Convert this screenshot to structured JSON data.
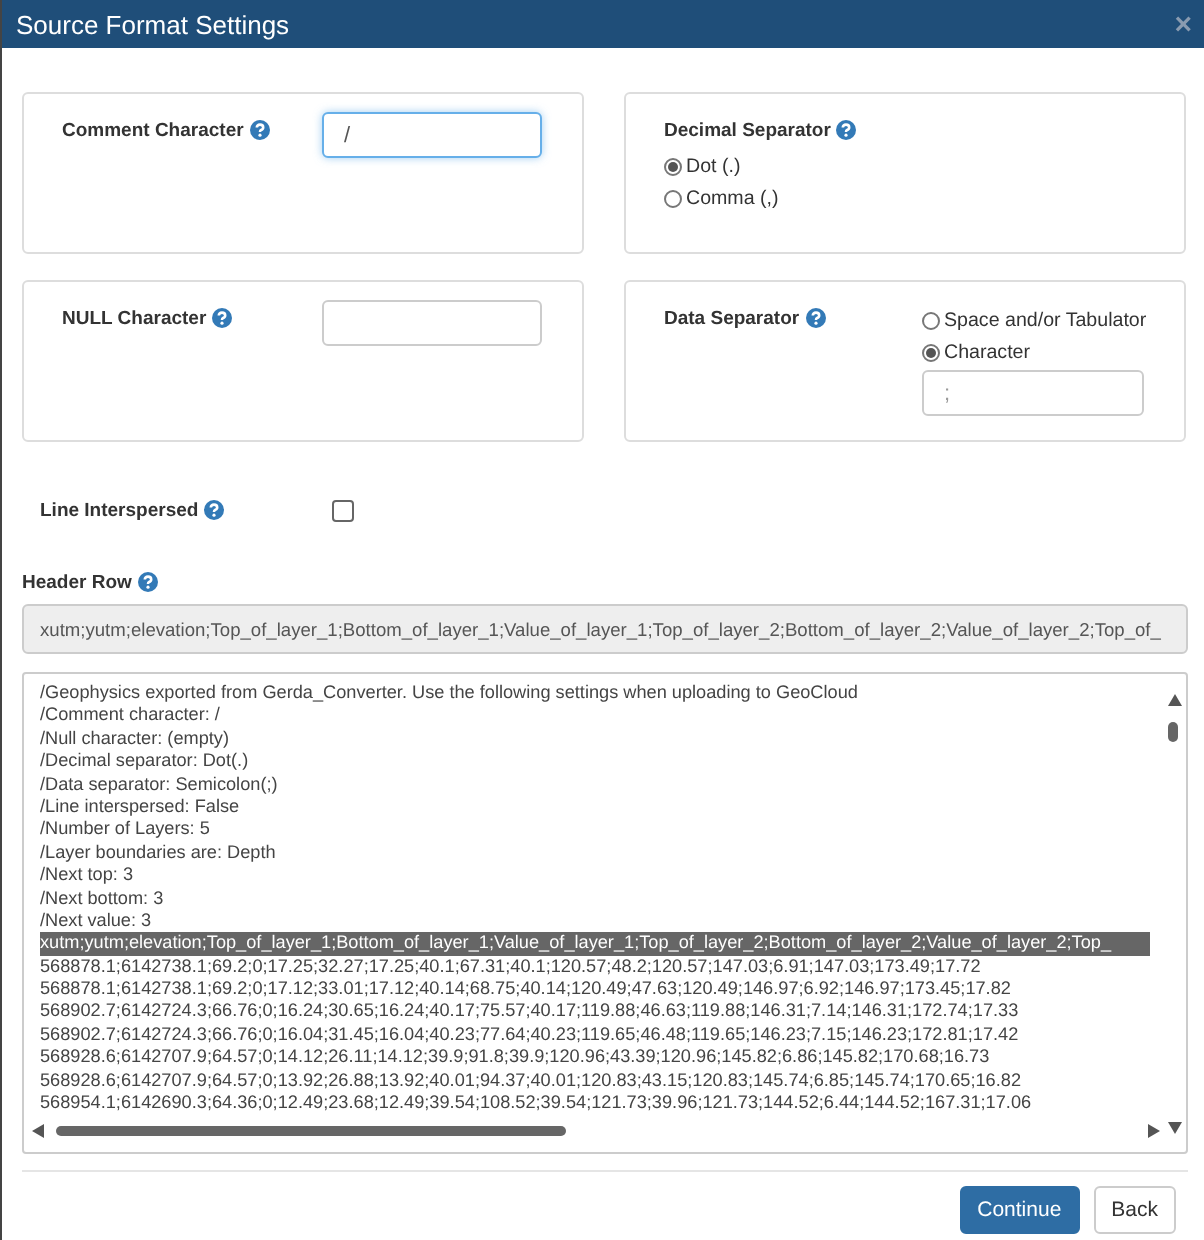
{
  "window": {
    "title": "Source Format Settings",
    "close": "×"
  },
  "settings": [
    {
      "kind": "text",
      "label": "Comment Character",
      "value": "/",
      "focused": true
    },
    {
      "kind": "radio",
      "label": "Decimal Separator",
      "options": [
        {
          "label": "Dot (.)",
          "selected": true
        },
        {
          "label": "Comma (,)",
          "selected": false
        }
      ]
    },
    {
      "kind": "text",
      "label": "NULL Character",
      "focused": false
    },
    {
      "kind": "radio-side",
      "label": "Data Separator",
      "options": [
        {
          "label": "Space and/or Tabulator",
          "selected": false
        },
        {
          "label": "Character",
          "selected": true,
          "placeholder": ";"
        }
      ]
    }
  ],
  "line_interspersed": {
    "label": "Line Interspersed",
    "checked": false
  },
  "header_row": {
    "label": "Header Row",
    "value": "xutm;yutm;elevation;Top_of_layer_1;Bottom_of_layer_1;Value_of_layer_1;Top_of_layer_2;Bottom_of_layer_2;Value_of_layer_2;Top_of_"
  },
  "preview": {
    "lines": [
      {
        "text": "/Geophysics exported from Gerda_Converter. Use the following settings when uploading to GeoCloud",
        "selected": false
      },
      {
        "text": "/Comment character: /",
        "selected": false
      },
      {
        "text": "/Null character: (empty)",
        "selected": false
      },
      {
        "text": "/Decimal separator: Dot(.)",
        "selected": false
      },
      {
        "text": "/Data separator: Semicolon(;)",
        "selected": false
      },
      {
        "text": "/Line interspersed: False",
        "selected": false
      },
      {
        "text": "/Number of Layers: 5",
        "selected": false
      },
      {
        "text": "/Layer boundaries are: Depth",
        "selected": false
      },
      {
        "text": "/Next top: 3",
        "selected": false
      },
      {
        "text": "/Next bottom: 3",
        "selected": false
      },
      {
        "text": "/Next value: 3",
        "selected": false
      },
      {
        "text": "xutm;yutm;elevation;Top_of_layer_1;Bottom_of_layer_1;Value_of_layer_1;Top_of_layer_2;Bottom_of_layer_2;Value_of_layer_2;Top_",
        "selected": true
      },
      {
        "text": "568878.1;6142738.1;69.2;0;17.25;32.27;17.25;40.1;67.31;40.1;120.57;48.2;120.57;147.03;6.91;147.03;173.49;17.72",
        "selected": false
      },
      {
        "text": "568878.1;6142738.1;69.2;0;17.12;33.01;17.12;40.14;68.75;40.14;120.49;47.63;120.49;146.97;6.92;146.97;173.45;17.82",
        "selected": false
      },
      {
        "text": "568902.7;6142724.3;66.76;0;16.24;30.65;16.24;40.17;75.57;40.17;119.88;46.63;119.88;146.31;7.14;146.31;172.74;17.33",
        "selected": false
      },
      {
        "text": "568902.7;6142724.3;66.76;0;16.04;31.45;16.04;40.23;77.64;40.23;119.65;46.48;119.65;146.23;7.15;146.23;172.81;17.42",
        "selected": false
      },
      {
        "text": "568928.6;6142707.9;64.57;0;14.12;26.11;14.12;39.9;91.8;39.9;120.96;43.39;120.96;145.82;6.86;145.82;170.68;16.73",
        "selected": false
      },
      {
        "text": "568928.6;6142707.9;64.57;0;13.92;26.88;13.92;40.01;94.37;40.01;120.83;43.15;120.83;145.74;6.85;145.74;170.65;16.82",
        "selected": false
      },
      {
        "text": "568954.1;6142690.3;64.36;0;12.49;23.68;12.49;39.54;108.52;39.54;121.73;39.96;121.73;144.52;6.44;144.52;167.31;17.06",
        "selected": false
      }
    ]
  },
  "buttons": [
    {
      "label": "Continue",
      "kind": "primary"
    },
    {
      "label": "Back",
      "kind": "default"
    }
  ]
}
